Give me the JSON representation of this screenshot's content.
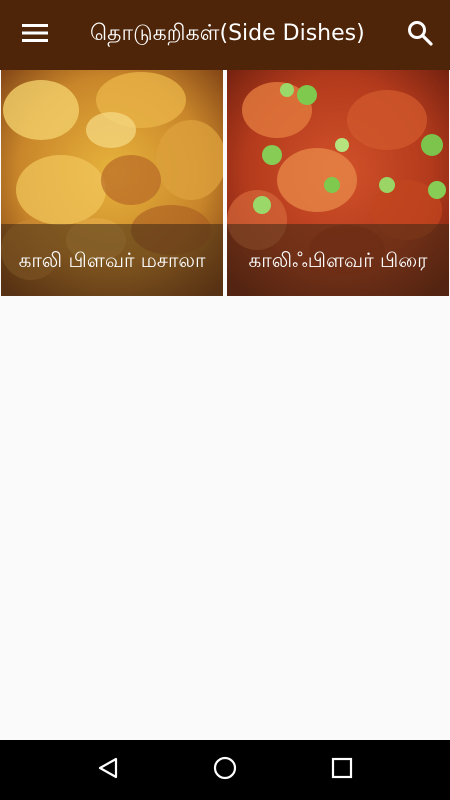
{
  "appbar": {
    "title": "தொடுகறிகள்(Side Dishes)",
    "menu_icon": "hamburger-menu-icon",
    "search_icon": "search-icon",
    "background": "#4e2508"
  },
  "recipes": [
    {
      "name": "காலி பிளவர் மசாலா",
      "image": "cauliflower-masala-photo"
    },
    {
      "name": "காலிஃபிளவர் பிரை",
      "image": "cauliflower-fry-photo"
    }
  ],
  "navbar": {
    "back_icon": "back-triangle-icon",
    "home_icon": "home-circle-icon",
    "recents_icon": "recents-square-icon"
  }
}
